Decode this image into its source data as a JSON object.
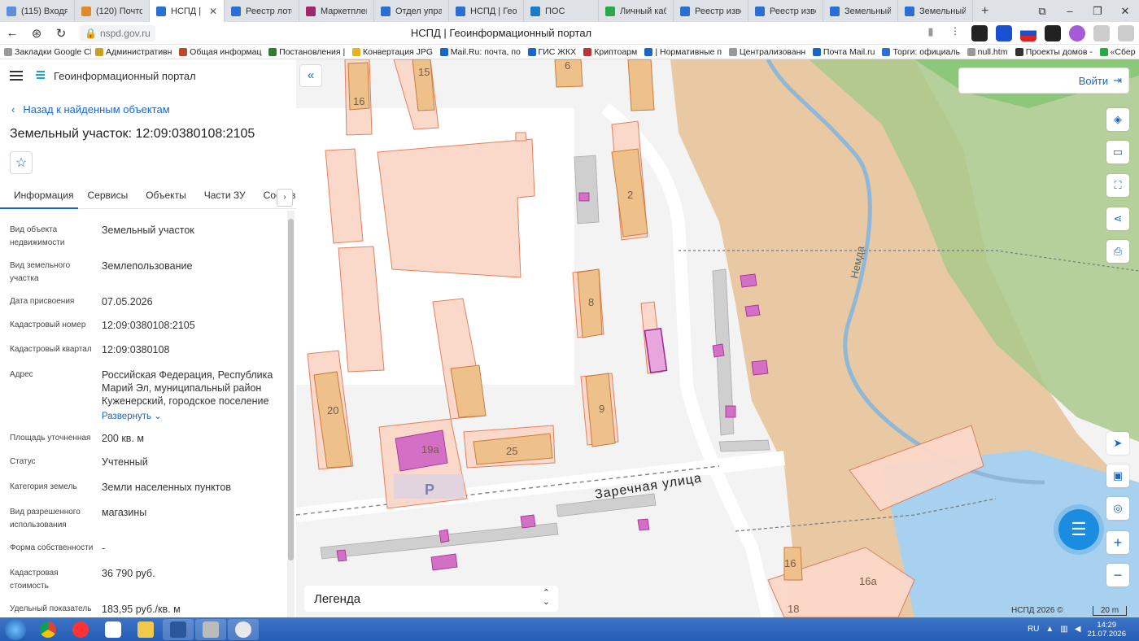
{
  "browser": {
    "tabs": [
      {
        "label": "(115) Входящ",
        "color": "#5b8fd9"
      },
      {
        "label": "(120) Почтов",
        "color": "#e08a2c"
      },
      {
        "label": "НСПД | Ге",
        "color": "#2a6fd1",
        "active": true
      },
      {
        "label": "Реестр лото",
        "color": "#2a6fd1"
      },
      {
        "label": "Маркетплей",
        "color": "#a0286a"
      },
      {
        "label": "Отдел управ",
        "color": "#2a6fd1"
      },
      {
        "label": "НСПД | Геои",
        "color": "#2a6fd1"
      },
      {
        "label": "ПОС",
        "color": "#1d7cc4"
      },
      {
        "label": "Личный каб",
        "color": "#2aa84a"
      },
      {
        "label": "Реестр изве",
        "color": "#2a6fd1"
      },
      {
        "label": "Реестр изве",
        "color": "#2a6fd1"
      },
      {
        "label": "Земельный у",
        "color": "#2a6fd1"
      },
      {
        "label": "Земельный у",
        "color": "#2a6fd1"
      }
    ],
    "url": "nspd.gov.ru",
    "page_title": "НСПД | Геоинформационный портал",
    "bookmarks": [
      {
        "label": "Закладки Google Ch",
        "color": "#999"
      },
      {
        "label": "Административн",
        "color": "#c8a11e"
      },
      {
        "label": "Общая информац",
        "color": "#b64a2a"
      },
      {
        "label": "Постановления |",
        "color": "#2f7d32"
      },
      {
        "label": "Конвертация JPG",
        "color": "#e6b21e"
      },
      {
        "label": "Mail.Ru: почта, по",
        "color": "#1a66c7"
      },
      {
        "label": "ГИС ЖКХ",
        "color": "#1a66c7"
      },
      {
        "label": "Криптоарм",
        "color": "#b33"
      },
      {
        "label": "| Нормативные п",
        "color": "#1a66c7"
      },
      {
        "label": "Централизованн",
        "color": "#999"
      },
      {
        "label": "Почта Mail.ru",
        "color": "#1a66c7"
      },
      {
        "label": "Торги: официаль",
        "color": "#2a6fd1"
      },
      {
        "label": "null.htm",
        "color": "#999"
      },
      {
        "label": "Проекты домов -",
        "color": "#333"
      },
      {
        "label": "«Сбер",
        "color": "#2aa84a"
      }
    ]
  },
  "panel": {
    "portal_name": "Геоинформационный портал",
    "back_link": "Назад к найденным объектам",
    "object_title": "Земельный участок: 12:09:0380108:2105",
    "tabs": [
      "Информация",
      "Сервисы",
      "Объекты",
      "Части ЗУ",
      "Состав"
    ],
    "rows": [
      {
        "label": "Вид объекта недвижимости",
        "value": "Земельный участок"
      },
      {
        "label": "Вид земельного участка",
        "value": "Землепользование"
      },
      {
        "label": "Дата присвоения",
        "value": "07.05.2026"
      },
      {
        "label": "Кадастровый номер",
        "value": "12:09:0380108:2105"
      },
      {
        "label": "Кадастровый квартал",
        "value": "12:09:0380108"
      },
      {
        "label": "Адрес",
        "value": "Российская Федерация, Республика Марий Эл, муниципальный район Куженерский, городское поселение"
      },
      {
        "label": "Площадь уточненная",
        "value": "200 кв. м"
      },
      {
        "label": "Статус",
        "value": "Учтенный"
      },
      {
        "label": "Категория земель",
        "value": "Земли населенных пунктов"
      },
      {
        "label": "Вид разрешенного использования",
        "value": "магазины"
      },
      {
        "label": "Форма собственности",
        "value": "-"
      },
      {
        "label": "Кадастровая стоимость",
        "value": "36 790 руб."
      },
      {
        "label": "Удельный показатель",
        "value": "183,95 руб./кв. м"
      }
    ],
    "expand_label": "Развернуть"
  },
  "map": {
    "login_label": "Войти",
    "legend_label": "Легенда",
    "street_label": "Заречная улица",
    "river_label": "Немда",
    "parking_label": "P",
    "building_numbers": [
      "15",
      "16",
      "6",
      "2",
      "8",
      "9",
      "20",
      "19а",
      "25",
      "16",
      "16а",
      "18"
    ],
    "copyright": "НСПД 2026 ©",
    "scale": "20 m"
  },
  "taskbar": {
    "lang": "RU",
    "time": "14:29",
    "date": "21.07.2026"
  }
}
